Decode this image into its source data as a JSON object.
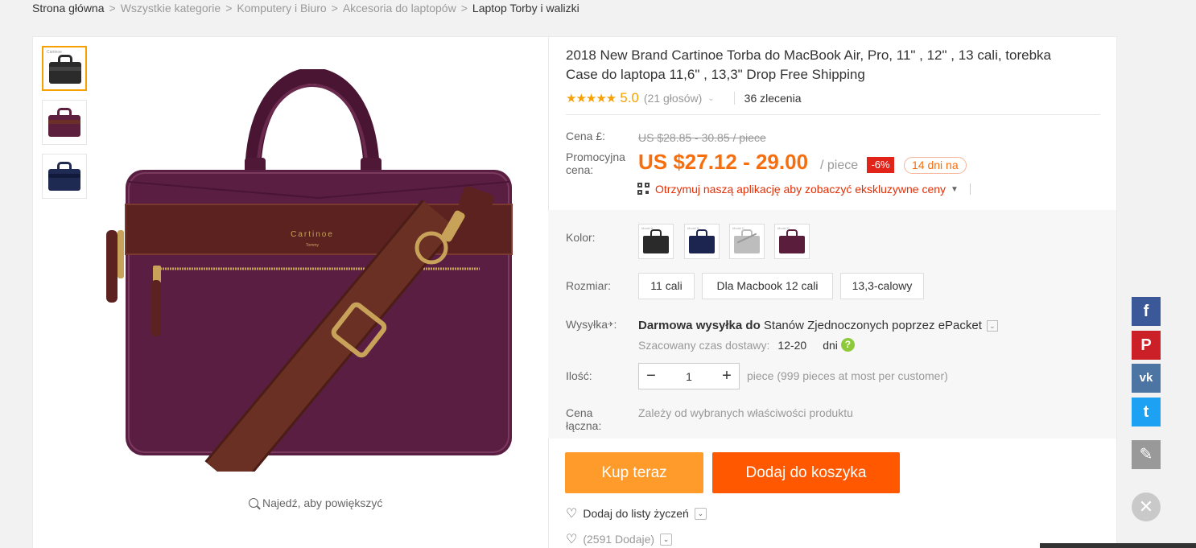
{
  "breadcrumb": [
    "Strona główna",
    "Wszystkie kategorie",
    "Komputery i Biuro",
    "Akcesoria do laptopów",
    "Laptop Torby i walizki"
  ],
  "breadcrumb_sep": ">",
  "gallery": {
    "thumbs": [
      {
        "name": "thumb-black",
        "color": "#2b2b2b",
        "label": "Cartinoe"
      },
      {
        "name": "thumb-purple",
        "color": "#5c1f3d",
        "label": ""
      },
      {
        "name": "thumb-navy",
        "color": "#1f2a52",
        "label": ""
      }
    ],
    "zoom_hint": "Najedź, aby powiększyć",
    "brand_text": "Cartinoe",
    "brand_sub": "Tommy"
  },
  "product": {
    "title": "2018 New Brand Cartinoe Torba do MacBook Air, Pro, 11\" , 12\" , 13 cali, torebka Case do laptopa 11,6\" , 13,3\" Drop Free Shipping",
    "stars": "★★★★★",
    "rating": "5.0",
    "votes": "(21 głosów)",
    "orders": "36 zlecenia"
  },
  "price": {
    "label": "Cena £:",
    "old": "US $28.85 - 30.85 / piece",
    "promo_label": "Promocyjna cena:",
    "promo": "US $27.12 - 29.00",
    "per": "/ piece",
    "discount": "-6%",
    "days": "14 dni na",
    "app_text": "Otrzymuj naszą aplikację aby zobaczyć ekskluzywne ceny"
  },
  "options": {
    "color_label": "Kolor:",
    "colors": [
      {
        "name": "black",
        "hex": "#2a2a2a"
      },
      {
        "name": "navy",
        "hex": "#1c2550"
      },
      {
        "name": "gray",
        "hex": "#bdbdbd"
      },
      {
        "name": "purple",
        "hex": "#5a1e3c"
      }
    ],
    "size_label": "Rozmiar:",
    "sizes": [
      "11 cali",
      "Dla Macbook 12 cali",
      "13,3-calowy"
    ]
  },
  "shipping": {
    "label": "Wysyłka",
    "free": "Darmowa wysyłka do",
    "dest": "Stanów Zjednoczonych poprzez ePacket",
    "eta_label": "Szacowany czas dostawy:",
    "eta_days": "12-20",
    "eta_unit": "dni"
  },
  "quantity": {
    "label": "Ilość:",
    "value": "1",
    "note": "piece (999 pieces at most per customer)"
  },
  "total": {
    "label": "Cena łączna:",
    "note": "Zależy od wybranych właściwości produktu"
  },
  "actions": {
    "buy": "Kup teraz",
    "cart": "Dodaj do koszyka",
    "wishlist": "Dodaj do listy życzeń",
    "added": "(2591 Dodaje)"
  },
  "social": [
    {
      "name": "facebook",
      "glyph": "f",
      "color": "#3b5998"
    },
    {
      "name": "pinterest",
      "glyph": "P",
      "color": "#cb2027"
    },
    {
      "name": "vk",
      "glyph": "vk",
      "color": "#4c75a3"
    },
    {
      "name": "twitter",
      "glyph": "t",
      "color": "#1da1f2"
    },
    {
      "name": "edit",
      "glyph": "✎",
      "color": "#999999"
    }
  ],
  "close_glyph": "✕"
}
